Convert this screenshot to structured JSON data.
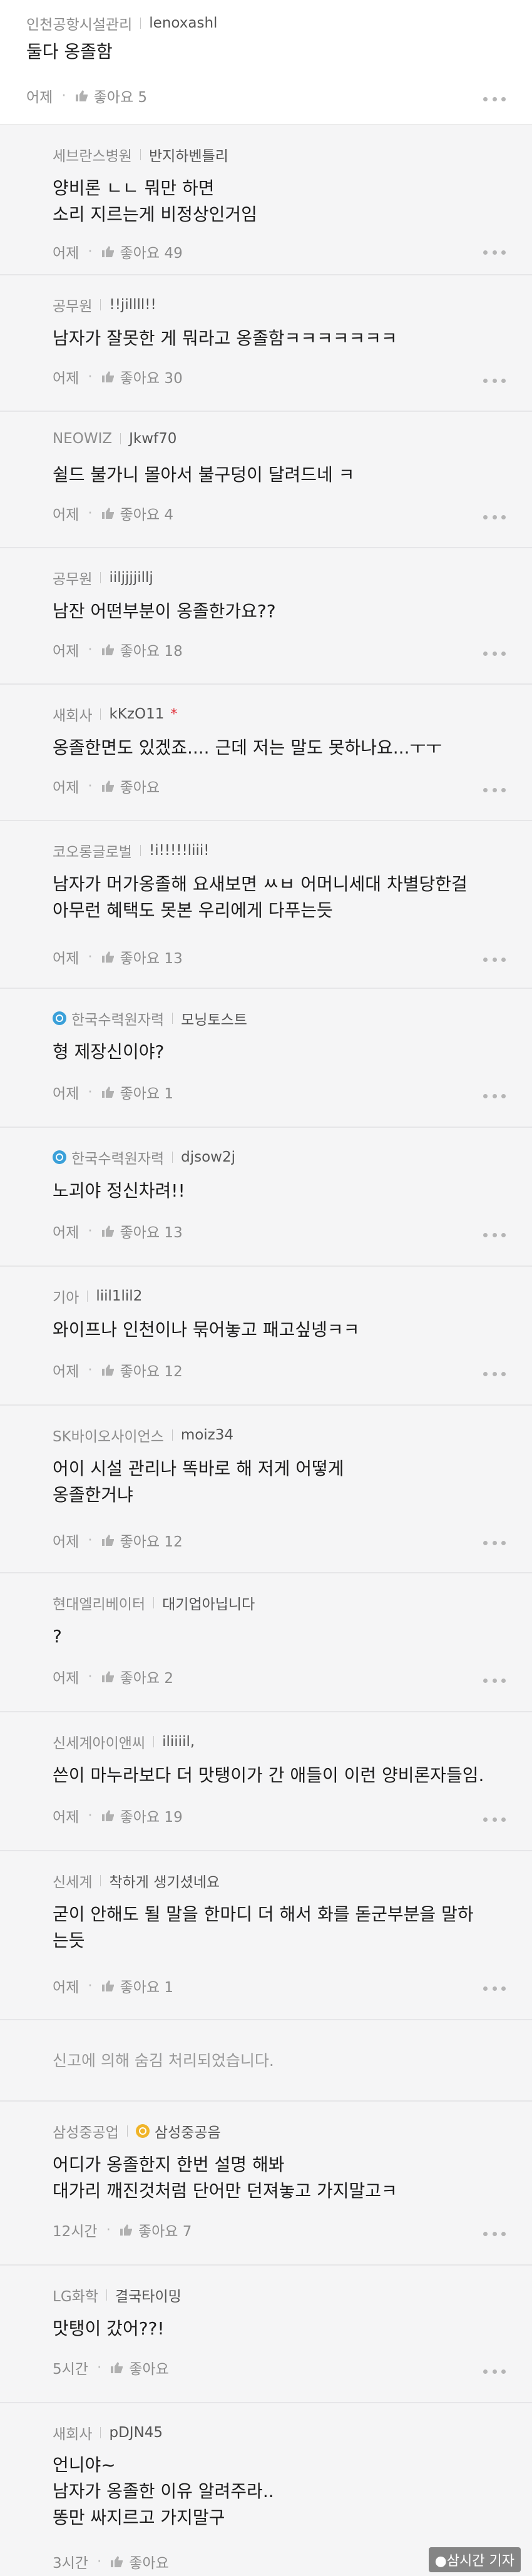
{
  "comments": [
    {
      "org": "인천공항시설관리",
      "nick": "lenoxashl",
      "text": "둘다 옹졸함",
      "time": "어제",
      "likes": "좋아요 5"
    },
    {
      "org": "세브란스병원",
      "nick": "반지하벤틀리",
      "text": "양비론 ㄴㄴ 뭐만 하면\n소리 지르는게 비정상인거임",
      "time": "어제",
      "likes": "좋아요 49"
    },
    {
      "org": "공무원",
      "nick": "!!jillll!!",
      "text": "남자가 잘못한 게 뭐라고 옹졸함ㅋㅋㅋㅋㅋㅋㅋ",
      "time": "어제",
      "likes": "좋아요 30"
    },
    {
      "org": "NEOWIZ",
      "nick": "Jkwf70",
      "text": "쉴드 불가니 몰아서 불구덩이 달려드네 ㅋ",
      "time": "어제",
      "likes": "좋아요 4"
    },
    {
      "org": "공무원",
      "nick": "iiljjjjillj",
      "text": "남잔 어떤부분이 옹졸한가요??",
      "time": "어제",
      "likes": "좋아요 18"
    },
    {
      "org": "새회사",
      "nick": "kKzO11",
      "new_mark": "*",
      "text": "옹졸한면도 있겠죠.... 근데 저는 말도 못하나요...ㅜㅜ",
      "time": "어제",
      "likes": "좋아요"
    },
    {
      "org": "코오롱글로벌",
      "nick": "!i!!!!!liii!",
      "text": "남자가 머가옹졸해 요새보면 ㅆㅂ 어머니세대 차별당한걸\n아무런 혜택도 못본 우리에게 다푸는듯",
      "time": "어제",
      "likes": "좋아요 13"
    },
    {
      "org": "한국수력원자력",
      "nick": "모닝토스트",
      "badge": "blue",
      "text": "형 제장신이야?",
      "time": "어제",
      "likes": "좋아요 1"
    },
    {
      "org": "한국수력원자력",
      "nick": "djsow2j",
      "badge": "blue",
      "text": "노괴야 정신차려!!",
      "time": "어제",
      "likes": "좋아요 13"
    },
    {
      "org": "기아",
      "nick": "liil1lil2",
      "text": "와이프나 인천이나 묶어놓고 패고싶넹ㅋㅋ",
      "time": "어제",
      "likes": "좋아요 12"
    },
    {
      "org": "SK바이오사이언스",
      "nick": "moiz34",
      "text": "어이 시설 관리나 똑바로 해 저게 어떻게\n옹졸한거냐",
      "time": "어제",
      "likes": "좋아요 12"
    },
    {
      "org": "현대엘리베이터",
      "nick": "대기업아닙니다",
      "text": "?",
      "time": "어제",
      "likes": "좋아요 2"
    },
    {
      "org": "신세계아이앤씨",
      "nick": "iliiiil,",
      "text": "쓴이 마누라보다 더 맛탱이가 간 애들이 이런 양비론자들임.",
      "time": "어제",
      "likes": "좋아요 19"
    },
    {
      "org": "신세계",
      "nick": "착하게 생기셨네요",
      "text": "굳이 안해도 될 말을 한마디 더 해서 화를 돋군부분을 말하\n는듯",
      "time": "어제",
      "likes": "좋아요 1"
    },
    {
      "hidden": "신고에 의해 숨김 처리되었습니다."
    },
    {
      "org": "삼성중공업",
      "nick": "삼성중공음",
      "badge": "gold",
      "text": "어디가 옹졸한지 한번 설명 해봐\n대가리 깨진것처럼 단어만 던져놓고 가지말고ㅋ",
      "time": "12시간",
      "likes": "좋아요 7"
    },
    {
      "org": "LG화학",
      "nick": "결국타이밍",
      "text": "맛탱이 갔어??!",
      "time": "5시간",
      "likes": "좋아요"
    },
    {
      "org": "새회사",
      "nick": "pDJN45",
      "text": "언니야~\n남자가 옹졸한 이유 알려주라..\n똥만 싸지르고 가지말구",
      "time": "3시간",
      "likes": "좋아요"
    }
  ],
  "watermark": "●삼시간 기자",
  "icons": {
    "like": "thumbs-up-icon",
    "more": "more-dots-icon",
    "badge": "company-badge-icon"
  }
}
